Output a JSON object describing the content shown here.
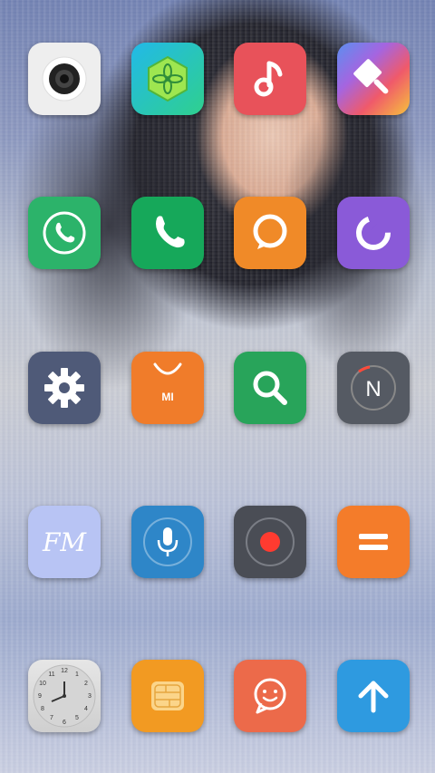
{
  "apps": [
    {
      "id": "camera",
      "icon": "camera-lens-icon",
      "color": "#eeeeee"
    },
    {
      "id": "themes",
      "icon": "hexagon-flower-icon",
      "color": "#20c8c8"
    },
    {
      "id": "music",
      "icon": "music-note-icon",
      "color": "#e8525a"
    },
    {
      "id": "themes-brush",
      "icon": "paint-brush-icon",
      "color": "#f0b030"
    },
    {
      "id": "whatsapp",
      "icon": "phone-bubble-icon",
      "color": "#2cb36a"
    },
    {
      "id": "phone",
      "icon": "phone-handset-icon",
      "color": "#16a85a"
    },
    {
      "id": "messaging",
      "icon": "chat-bubble-icon",
      "color": "#f08a28"
    },
    {
      "id": "security",
      "icon": "shield-swirl-icon",
      "color": "#8a5ad8"
    },
    {
      "id": "settings",
      "icon": "gear-icon",
      "color": "#4f5a78"
    },
    {
      "id": "mi-store",
      "icon": "shopping-bag-icon",
      "color": "#f07c2a",
      "badge": "MI"
    },
    {
      "id": "search",
      "icon": "search-icon",
      "color": "#28a45a"
    },
    {
      "id": "compass",
      "icon": "compass-n-icon",
      "color": "#555a63",
      "badge": "N"
    },
    {
      "id": "fm-radio",
      "icon": "fm-radio-icon",
      "color": "#b8c4f4",
      "badge": "FM"
    },
    {
      "id": "recorder",
      "icon": "microphone-icon",
      "color": "#2e86c8"
    },
    {
      "id": "screen-recorder",
      "icon": "record-dot-icon",
      "color": "#4a4d55"
    },
    {
      "id": "calculator",
      "icon": "equals-icon",
      "color": "#f47c2a"
    },
    {
      "id": "clock",
      "icon": "clock-face-icon",
      "color": "#d8d8d8",
      "clock_numbers": [
        "12",
        "1",
        "2",
        "3",
        "4",
        "5",
        "6",
        "7",
        "8",
        "9",
        "10",
        "11"
      ]
    },
    {
      "id": "sim-toolkit",
      "icon": "sim-card-icon",
      "color": "#f29a22"
    },
    {
      "id": "feedback",
      "icon": "smiley-bubble-icon",
      "color": "#ec6a4a"
    },
    {
      "id": "updater",
      "icon": "arrow-up-icon",
      "color": "#2e9ae0"
    }
  ]
}
